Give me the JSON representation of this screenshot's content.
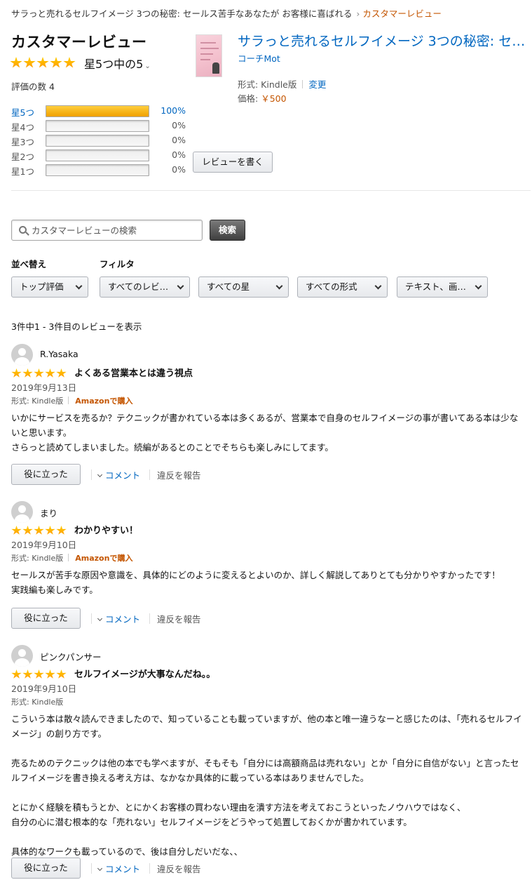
{
  "breadcrumb": {
    "book": "サラっと売れるセルフイメージ 3つの秘密: セールス苦手なあなたが お客様に喜ばれる",
    "separator": "›",
    "current": "カスタマーレビュー"
  },
  "header": {
    "title": "カスタマーレビュー",
    "overall_rating": 5,
    "overall_text": "星5つ中の5",
    "rating_count": "評価の数 4"
  },
  "histogram": [
    {
      "label": "星5つ",
      "percent": 100,
      "percent_text": "100%"
    },
    {
      "label": "星4つ",
      "percent": 0,
      "percent_text": "0%"
    },
    {
      "label": "星3つ",
      "percent": 0,
      "percent_text": "0%"
    },
    {
      "label": "星2つ",
      "percent": 0,
      "percent_text": "0%"
    },
    {
      "label": "星1つ",
      "percent": 0,
      "percent_text": "0%"
    }
  ],
  "write_review_label": "レビューを書く",
  "book": {
    "title": "サラっと売れるセルフイメージ 3つの秘密: セールス苦手なあなたが お客様に喜ばれる",
    "author": "コーチMot",
    "format_label": "形式: Kindle版",
    "change_label": "変更",
    "price_label": "価格:",
    "price": "￥500"
  },
  "search": {
    "placeholder": "カスタマーレビューの検索",
    "button_label": "検索"
  },
  "sort": {
    "label": "並べ替え",
    "selected": "トップ評価"
  },
  "filter": {
    "label": "フィルタ",
    "reviewer": "すべてのレビ…",
    "stars": "すべての星",
    "format": "すべての形式",
    "media": "テキスト、画…"
  },
  "result_count": "3件中1 - 3件目のレビューを表示",
  "review_actions": {
    "helpful": "役に立った",
    "comment": "コメント",
    "report": "違反を報告"
  },
  "reviews": [
    {
      "name": "R.Yasaka",
      "rating": 5,
      "title": "よくある営業本とは違う視点",
      "date": "2019年9月13日",
      "format": "形式: Kindle版",
      "verified": "Amazonで購入",
      "body": [
        "いかにサービスを売るか？テクニックが書かれている本は多くあるが、営業本で自身のセルフイメージの事が書いてある本は少ないと思います。",
        "さらっと読めてしまいました。続編があるとのことでそちらも楽しみにしてます。"
      ]
    },
    {
      "name": "まり",
      "rating": 5,
      "title": "わかりやすい！",
      "date": "2019年9月10日",
      "format": "形式: Kindle版",
      "verified": "Amazonで購入",
      "body": [
        "セールスが苦手な原因や意識を、具体的にどのように変えるとよいのか、詳しく解説してありとても分かりやすかったです！",
        "実践編も楽しみです。"
      ]
    },
    {
      "name": "ピンクパンサー",
      "rating": 5,
      "title": "セルフイメージが大事なんだね。。",
      "date": "2019年9月10日",
      "format": "形式: Kindle版",
      "verified": "",
      "body": [
        "こういう本は散々読んできましたので、知っていることも載っていますが、他の本と唯一違うなーと感じたのは、「売れるセルフイメージ」の創り方です。",
        "",
        "売るためのテクニックは他の本でも学べますが、そもそも「自分には高額商品は売れない」とか「自分に自信がない」と言ったセルフイメージを書き換える考え方は、なかなか具体的に載っている本はありませんでした。",
        "",
        "とにかく経験を積もうとか、とにかくお客様の買わない理由を潰す方法を考えておこうといったノウハウではなく、",
        "自分の心に潜む根本的な「売れない」セルフイメージをどうやって処置しておくかが書かれています。",
        "",
        "具体的なワークも載っているので、後は自分しだいだな、、"
      ]
    }
  ],
  "colors": {
    "link": "#0066c0",
    "accent": "#c45500",
    "star": "#ffa41c",
    "bar_fill": "#f0a000"
  }
}
